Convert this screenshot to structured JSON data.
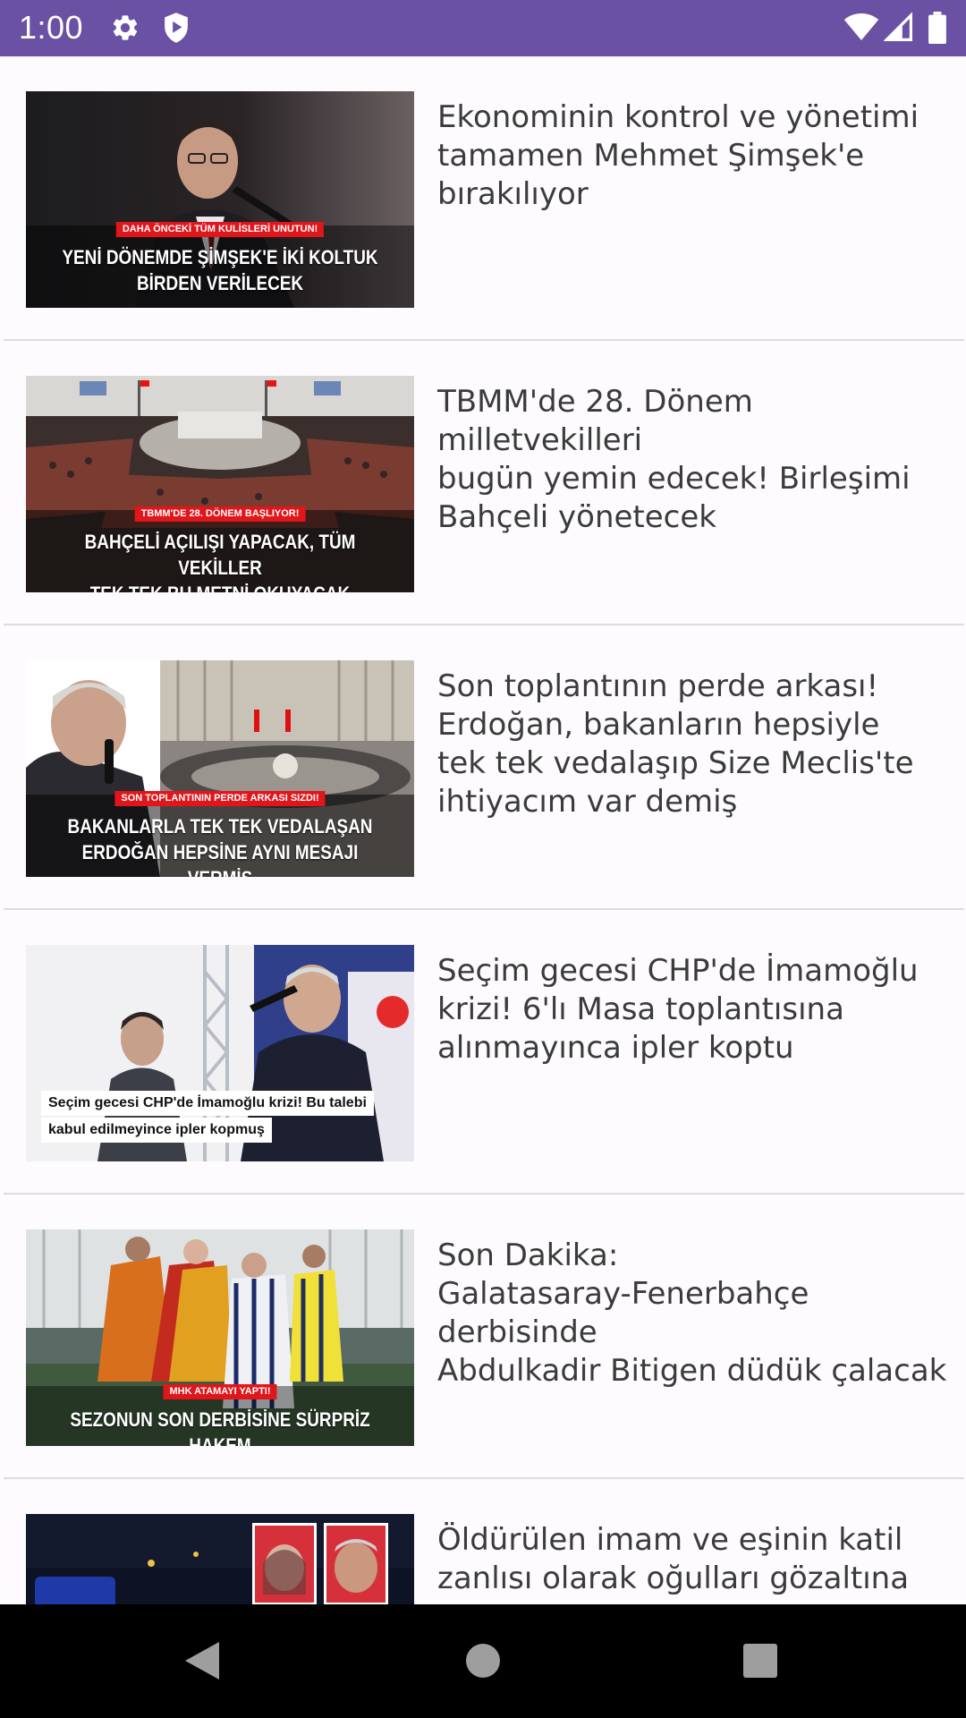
{
  "status_bar": {
    "time": "1:00",
    "background": "#6b51a3",
    "left_icons": [
      "gear-icon",
      "shield-play-icon"
    ],
    "right_icons": [
      "wifi-icon",
      "cell-signal-icon",
      "battery-icon"
    ]
  },
  "feed": {
    "items": [
      {
        "title": "Ekonominin kontrol ve yönetimi\ntamamen Mehmet Şimşek'e\nbırakılıyor",
        "thumb_kicker": "DAHA ÖNCEKİ TÜM KULİSLERİ UNUTUN!",
        "thumb_headline": "YENİ DÖNEMDE ŞİMŞEK'E İKİ KOLTUK\nBİRDEN VERİLECEK"
      },
      {
        "title": "TBMM'de 28. Dönem milletvekilleri\nbugün yemin edecek! Birleşimi\nBahçeli yönetecek",
        "thumb_kicker": "TBMM'DE 28. DÖNEM BAŞLIYOR!",
        "thumb_headline": "BAHÇELİ AÇILIŞI YAPACAK, TÜM VEKİLLER\nTEK TEK BU METNİ OKUYACAK"
      },
      {
        "title": "Son toplantının perde arkası!\nErdoğan, bakanların hepsiyle\ntek tek vedalaşıp Size Meclis'te\nihtiyacım var demiş",
        "thumb_kicker": "SON TOPLANTININ PERDE ARKASI SIZDI!",
        "thumb_headline": "BAKANLARLA TEK TEK VEDALAŞAN\nERDOĞAN HEPSİNE AYNI MESAJI VERMİŞ"
      },
      {
        "title": "Seçim gecesi CHP'de İmamoğlu\nkrizi! 6'lı Masa toplantısına\nalınmayınca ipler koptu",
        "thumb_caption_line1": "Seçim gecesi CHP'de İmamoğlu krizi! Bu talebi",
        "thumb_caption_line2": "kabul edilmeyince ipler kopmuş"
      },
      {
        "title": "Son Dakika:\nGalatasaray-Fenerbahçe derbisinde\nAbdulkadir Bitigen düdük çalacak",
        "thumb_kicker": "MHK ATAMAYI YAPTI!",
        "thumb_headline": "SEZONUN SON DERBİSİNE SÜRPRİZ HAKEM"
      },
      {
        "title": "Öldürülen imam ve eşinin katil\nzanlısı olarak oğulları gözaltına"
      }
    ]
  },
  "nav_bar": {
    "buttons": [
      "back-icon",
      "home-icon",
      "recents-icon"
    ]
  }
}
